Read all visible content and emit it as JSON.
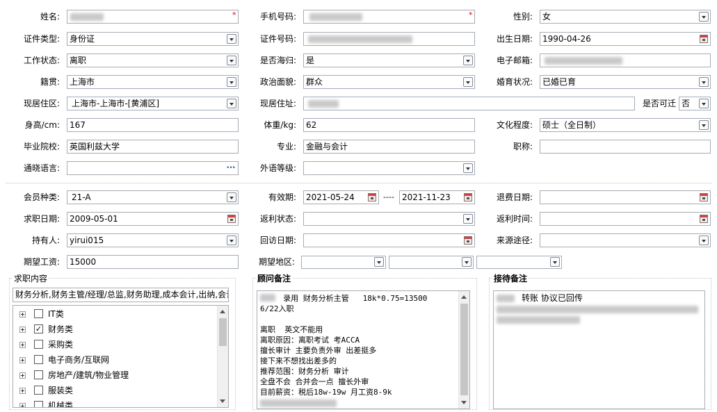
{
  "personal": {
    "name_label": "姓名:",
    "mobile_label": "手机号码:",
    "gender_label": "性别:",
    "gender_value": "女",
    "idtype_label": "证件类型:",
    "idtype_value": "身份证",
    "idno_label": "证件号码:",
    "birth_label": "出生日期:",
    "birth_value": "1990-04-26",
    "workstatus_label": "工作状态:",
    "workstatus_value": "离职",
    "returnee_label": "是否海归:",
    "returnee_value": "是",
    "email_label": "电子邮箱:",
    "native_label": "籍贯:",
    "native_value": "上海市",
    "political_label": "政治面貌:",
    "political_value": "群众",
    "marital_label": "婚育状况:",
    "marital_value": "已婚已育",
    "residence_area_label": "现居住区:",
    "residence_area_value": "上海市-上海市-[黄浦区]",
    "residence_addr_label": "现居住址:",
    "relocate_label": "是否可迁",
    "relocate_value": "否",
    "height_label": "身高/cm:",
    "height_value": "167",
    "weight_label": "体重/kg:",
    "weight_value": "62",
    "education_label": "文化程度:",
    "education_value": "硕士（全日制）",
    "school_label": "毕业院校:",
    "school_value": "英国利兹大学",
    "major_label": "专业:",
    "major_value": "金融与会计",
    "title_label": "职称:",
    "language_label": "通晓语言:",
    "language_btn": "•••",
    "foreign_level_label": "外语等级:"
  },
  "membership": {
    "type_label": "会员种类:",
    "type_value": "21-A",
    "valid_label": "有效期:",
    "valid_from": "2021-05-24",
    "valid_sep": "----",
    "valid_to": "2021-11-23",
    "refund_label": "退费日期:",
    "jobseek_date_label": "求职日期:",
    "jobseek_date_value": "2009-05-01",
    "rebate_status_label": "返利状态:",
    "rebate_time_label": "返利时间:",
    "holder_label": "持有人:",
    "holder_value": "yirui015",
    "revisit_label": "回访日期:",
    "source_label": "来源途径:",
    "salary_label": "期望工资:",
    "salary_value": "15000",
    "region_label": "期望地区:"
  },
  "job_panel": {
    "title": "求职内容",
    "summary": "财务分析,财务主管/经理/总监,财务助理,成本会计,出纳,会计",
    "tree": [
      {
        "label": "IT类",
        "checked": false
      },
      {
        "label": "财务类",
        "checked": true
      },
      {
        "label": "采购类",
        "checked": false
      },
      {
        "label": "电子商务/互联网",
        "checked": false
      },
      {
        "label": "房地产/建筑/物业管理",
        "checked": false
      },
      {
        "label": "服装类",
        "checked": false
      },
      {
        "label": "机械类",
        "checked": false
      }
    ]
  },
  "consultant_panel": {
    "title": "顾问备注",
    "lines": [
      "录用 财务分析主管   18k*0.75=13500",
      "6/22入职",
      "",
      "离职  英文不能用",
      "离职原因：离职考试 考ACCA",
      "擅长审计 主要负责外审 出差挺多",
      "接下来不想找出差多的",
      "推荐范围：财务分析 审计",
      "全盘不会 合并会一点 擅长外审",
      "目前薪资：税后18w-19w 月工资8-9k"
    ]
  },
  "reception_panel": {
    "title": "接待备注",
    "line1": "转账 协议已回传"
  },
  "colors": {
    "border": "#a5acb5",
    "required": "#dd0000",
    "panel_border": "#c4c4c4"
  }
}
